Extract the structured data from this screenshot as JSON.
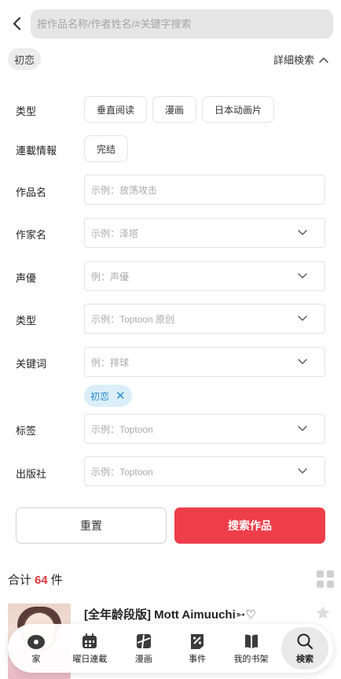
{
  "search": {
    "placeholder": "按作品名称/作者姓名/#关键字搜索"
  },
  "active_chip": "初恋",
  "advanced_toggle_label": "詳細検索",
  "filters": {
    "type_label": "类型",
    "type_options": [
      "垂直阅读",
      "漫画",
      "日本动画片"
    ],
    "serial_label": "連載情報",
    "serial_options": [
      "完结"
    ],
    "title_label": "作品名",
    "title_placeholder": "示例：放荡攻击",
    "author_label": "作家名",
    "author_placeholder": "示例：泽塔",
    "voice_label": "声優",
    "voice_placeholder": "例：声優",
    "genre_label": "类型",
    "genre_placeholder": "示例：Toptoon 原创",
    "keyword_label": "关键词",
    "keyword_placeholder": "例：排球",
    "keyword_chip": "初恋",
    "keyword_chip_remove": "✕",
    "tag_label": "标签",
    "tag_placeholder": "示例：Toptoon",
    "publisher_label": "出版社",
    "publisher_placeholder": "示例：Toptoon"
  },
  "actions": {
    "reset_label": "重置",
    "submit_label": "搜索作品"
  },
  "results": {
    "prefix": "合计",
    "count": "64",
    "suffix": "件",
    "items": [
      {
        "title": "[全年龄段版] Mott Aimuuchi➳♡"
      }
    ]
  },
  "bottom_nav": [
    {
      "label": "家",
      "icon": "home-icon",
      "active": false
    },
    {
      "label": "曜日連載",
      "icon": "calendar-icon",
      "active": false
    },
    {
      "label": "漫画",
      "icon": "comic-icon",
      "active": false
    },
    {
      "label": "事件",
      "icon": "event-icon",
      "active": false
    },
    {
      "label": "我的书架",
      "icon": "bookshelf-icon",
      "active": false
    },
    {
      "label": "検索",
      "icon": "search-icon",
      "active": true
    }
  ],
  "colors": {
    "accent": "#ed3e4a",
    "count": "#e0393f",
    "chip_bg": "#dbeef9",
    "chip_text": "#2a8ccc"
  }
}
